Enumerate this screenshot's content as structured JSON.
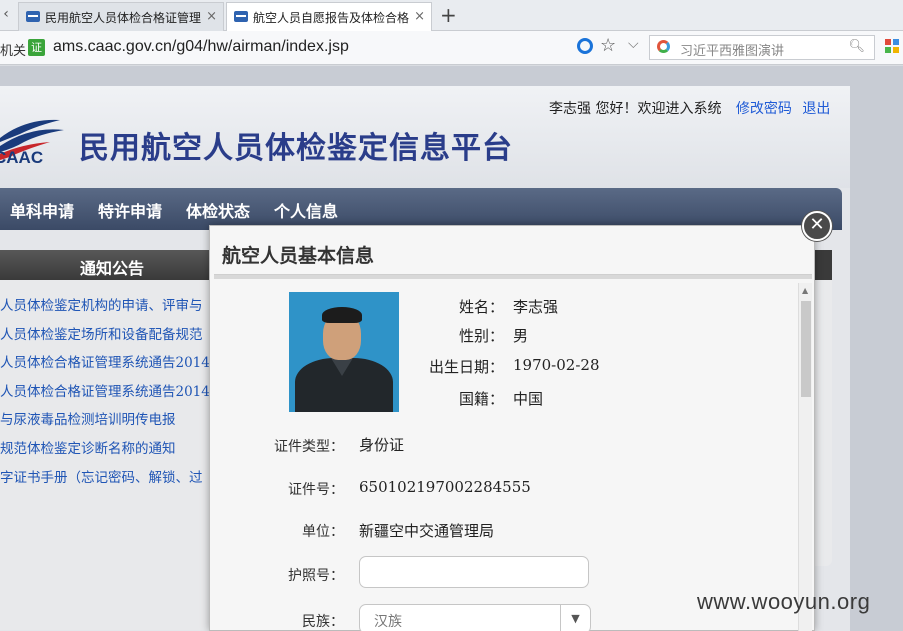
{
  "browser": {
    "tabs": [
      {
        "label": "民用航空人员体检合格证管理",
        "active": false
      },
      {
        "label": "航空人员自愿报告及体检合格",
        "active": true
      }
    ],
    "tab_scroll_glyph": "‹",
    "close_glyph": "×",
    "new_tab_glyph": "+",
    "address_left_text": "机关",
    "cert_badge": "证",
    "url": "ams.caac.gov.cn/g04/hw/airman/index.jsp",
    "search_placeholder": "习近平西雅图演讲"
  },
  "site": {
    "logo_text": "CAAC",
    "title": "民用航空人员体检鉴定信息平台",
    "greeting": "李志强  您好！欢迎进入系统",
    "edit_password": "修改密码",
    "logout": "退出",
    "nav": [
      "单科申请",
      "特许申请",
      "体检状态",
      "个人信息"
    ],
    "notice_title": "通知公告",
    "notices": [
      "人员体检鉴定机构的申请、评审与",
      "人员体检鉴定场所和设备配备规范",
      "人员体检合格证管理系统通告2014",
      "人员体检合格证管理系统通告2014",
      "与尿液毒品检测培训明传电报",
      "规范体检鉴定诊断名称的通知",
      "字证书手册（忘记密码、解锁、过"
    ]
  },
  "modal": {
    "title": "航空人员基本信息",
    "close_glyph": "✕",
    "basic": [
      {
        "label": "姓名：",
        "value": "李志强"
      },
      {
        "label": "性别：",
        "value": "男"
      },
      {
        "label": "出生日期：",
        "value": "1970-02-28"
      },
      {
        "label": "国籍：",
        "value": "中国"
      }
    ],
    "fields": {
      "cert_type_label": "证件类型：",
      "cert_type_value": "身份证",
      "cert_no_label": "证件号：",
      "cert_no_value": "650102197002284555",
      "unit_label": "单位：",
      "unit_value": "新疆空中交通管理局",
      "passport_label": "护照号：",
      "passport_value": "",
      "ethnicity_label": "民族：",
      "ethnicity_value": "汉族"
    }
  },
  "watermark": "www.wooyun.org"
}
